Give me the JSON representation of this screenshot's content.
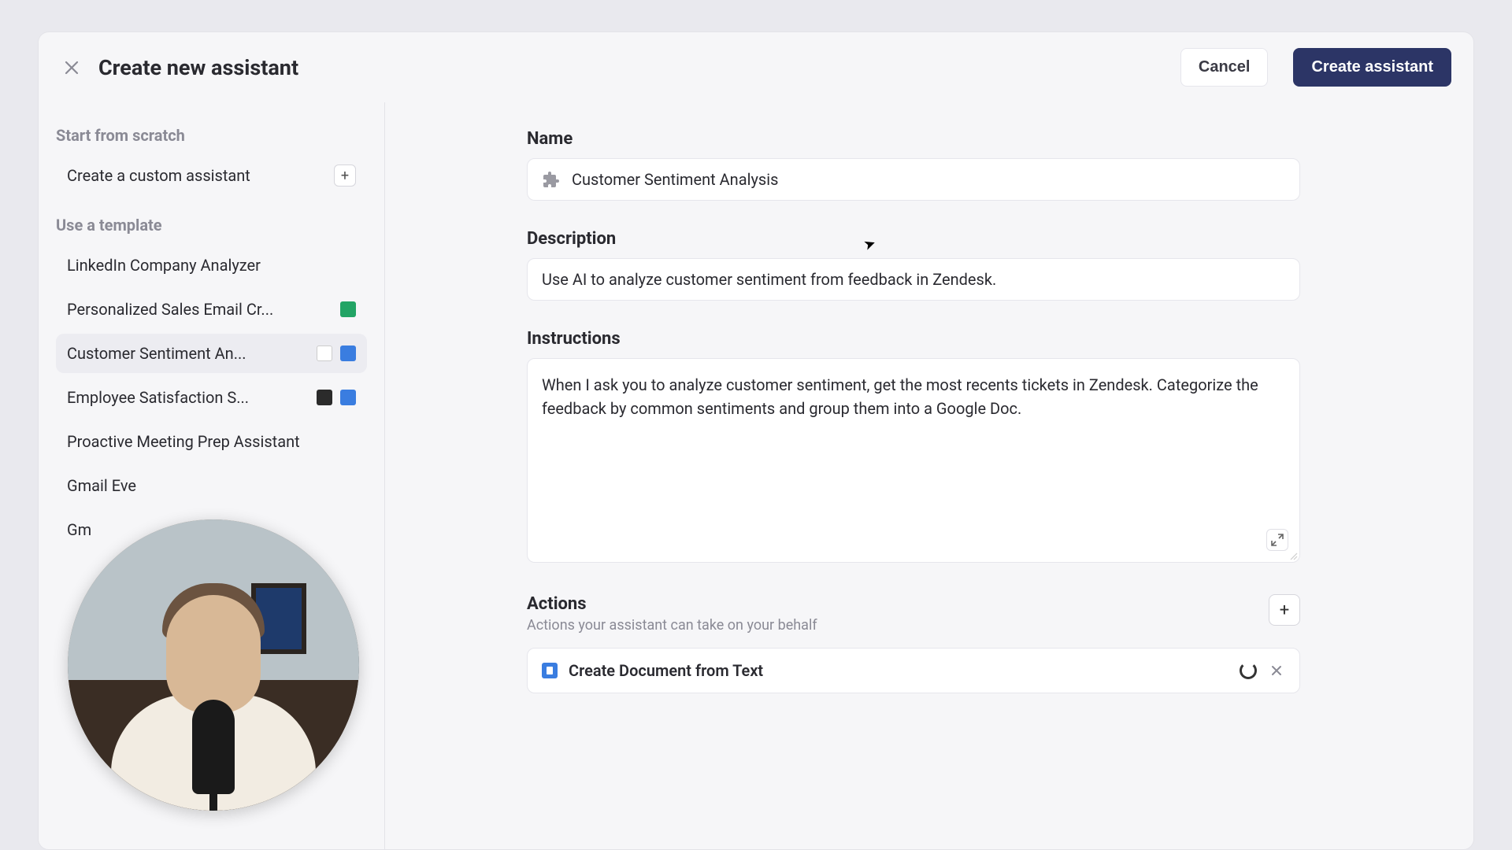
{
  "header": {
    "title": "Create new assistant",
    "cancel": "Cancel",
    "create": "Create assistant"
  },
  "sidebar": {
    "scratch_label": "Start from scratch",
    "custom_label": "Create a custom assistant",
    "template_label": "Use a template",
    "templates": [
      {
        "label": "LinkedIn Company Analyzer",
        "icons": []
      },
      {
        "label": "Personalized Sales Email Cr...",
        "icons": [
          "sheets"
        ]
      },
      {
        "label": "Customer Sentiment An...",
        "icons": [
          "zendesk",
          "docs"
        ],
        "selected": true
      },
      {
        "label": "Employee Satisfaction S...",
        "icons": [
          "dark",
          "docs"
        ]
      },
      {
        "label": "Proactive Meeting Prep Assistant",
        "icons": []
      },
      {
        "label": "Gmail Eve",
        "icons": []
      },
      {
        "label": "Gm",
        "icons": []
      }
    ]
  },
  "form": {
    "name_label": "Name",
    "name_value": "Customer Sentiment Analysis",
    "desc_label": "Description",
    "desc_value": "Use AI to analyze customer sentiment from feedback in Zendesk.",
    "instr_label": "Instructions",
    "instr_value": "When I ask you to analyze customer sentiment, get the most recents tickets in Zendesk. Categorize the feedback by common sentiments and group them into a Google Doc.",
    "actions_label": "Actions",
    "actions_sub": "Actions your assistant can take on your behalf",
    "action_item": "Create Document from Text"
  }
}
